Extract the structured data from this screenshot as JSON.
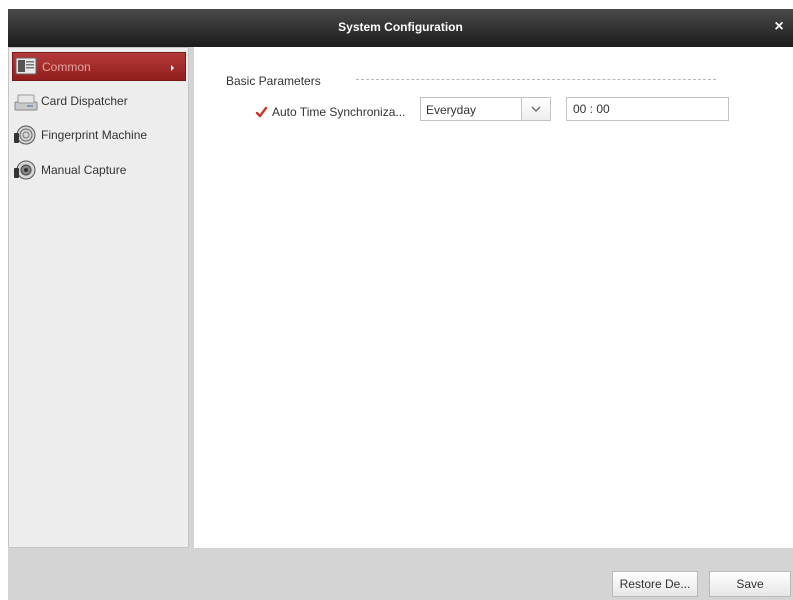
{
  "window": {
    "title": "System Configuration",
    "close_icon": "close-icon"
  },
  "sidebar": {
    "items": [
      {
        "label": "Common",
        "icon": "common-settings-icon",
        "active": true
      },
      {
        "label": "Card Dispatcher",
        "icon": "card-dispatcher-icon",
        "active": false
      },
      {
        "label": "Fingerprint Machine",
        "icon": "fingerprint-machine-icon",
        "active": false
      },
      {
        "label": "Manual Capture",
        "icon": "manual-capture-icon",
        "active": false
      }
    ]
  },
  "content": {
    "section_title": "Basic Parameters",
    "auto_time_sync": {
      "label": "Auto Time Synchroniza...",
      "checked": true,
      "frequency": "Everyday",
      "time": "00 : 00"
    }
  },
  "footer": {
    "restore_label": "Restore De...",
    "save_label": "Save"
  },
  "colors": {
    "title_bar": "#1c1c1c",
    "active_item": "#a52d2b",
    "check_mark": "#c0392b",
    "panel_bg": "#d4d4d4"
  }
}
